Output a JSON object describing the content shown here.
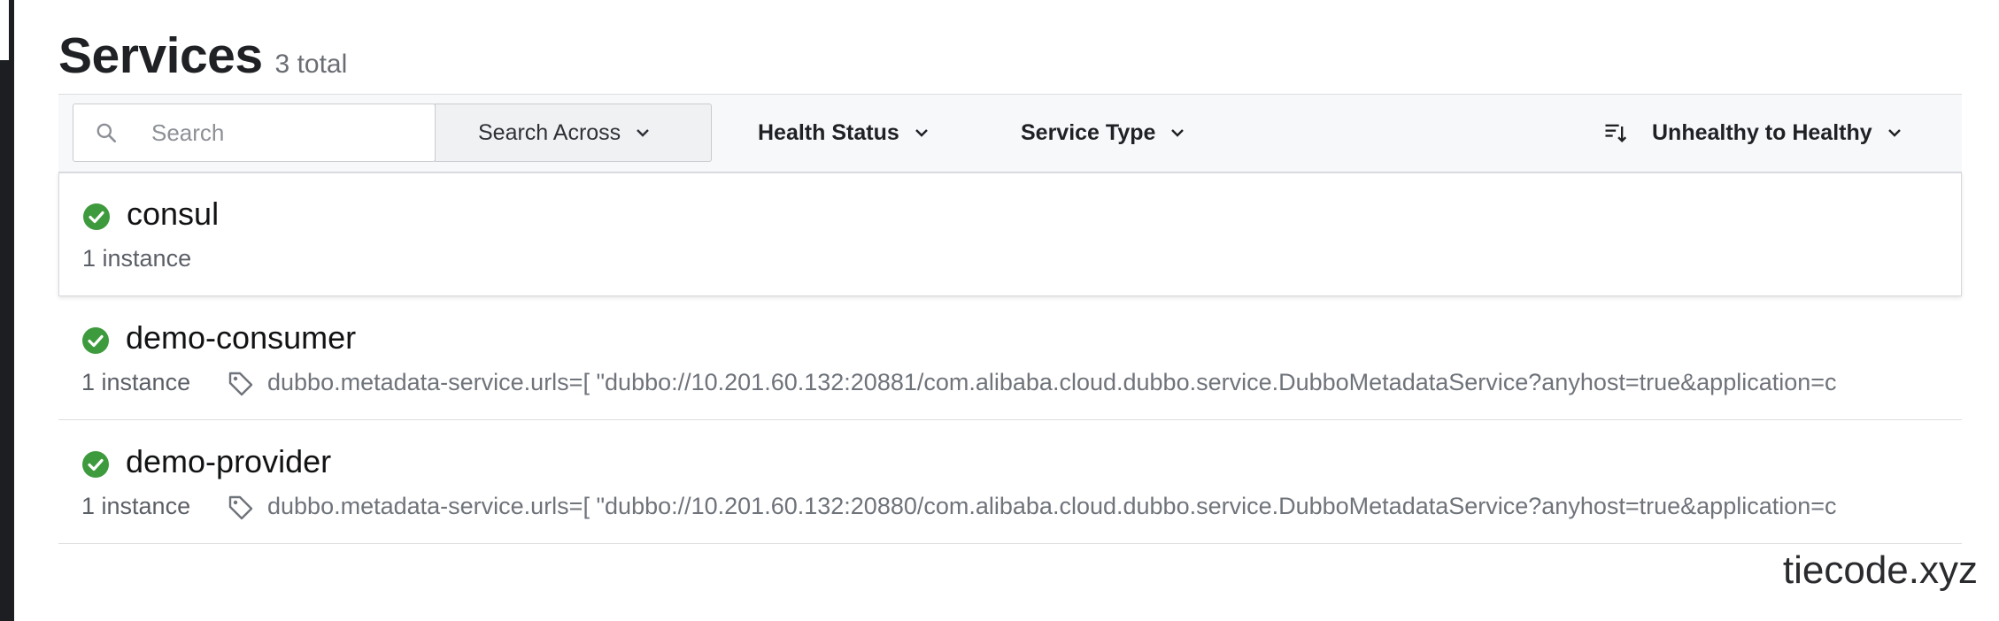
{
  "header": {
    "title": "Services",
    "total": "3 total"
  },
  "toolbar": {
    "search_placeholder": "Search",
    "search_across": "Search Across",
    "health_status": "Health Status",
    "service_type": "Service Type",
    "sort": "Unhealthy to Healthy"
  },
  "services": [
    {
      "name": "consul",
      "instances": "1 instance",
      "tag": "",
      "status": "healthy"
    },
    {
      "name": "demo-consumer",
      "instances": "1 instance",
      "tag": "dubbo.metadata-service.urls=[ \"dubbo://10.201.60.132:20881/com.alibaba.cloud.dubbo.service.DubboMetadataService?anyhost=true&application=c",
      "status": "healthy"
    },
    {
      "name": "demo-provider",
      "instances": "1 instance",
      "tag": "dubbo.metadata-service.urls=[ \"dubbo://10.201.60.132:20880/com.alibaba.cloud.dubbo.service.DubboMetadataService?anyhost=true&application=c",
      "status": "healthy"
    }
  ],
  "watermark": "tiecode.xyz",
  "colors": {
    "healthy": "#3d9a3d",
    "accent_border": "#c8cbd0"
  }
}
